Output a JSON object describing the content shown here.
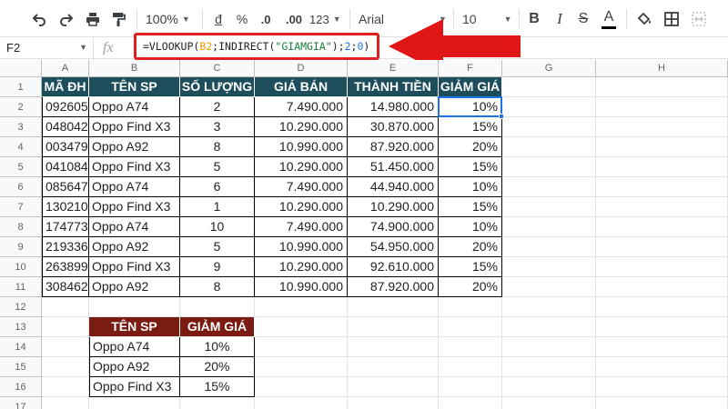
{
  "toolbar": {
    "zoom": "100%",
    "currency": "đ",
    "percent": "%",
    "dec_decrease": ".0",
    "dec_increase": ".00",
    "more_formats": "123",
    "font": "Arial",
    "font_size": "10",
    "bold": "B",
    "italic": "I",
    "strike": "S",
    "text_color": "A"
  },
  "formula_bar": {
    "name_box": "F2",
    "fx": "fx",
    "formula_parts": {
      "p1": "=VLOOKUP(",
      "ref": "B2",
      "p2": ";INDIRECT(",
      "str": "\"GIAMGIA\"",
      "p3": ");",
      "n1": "2",
      "p4": ";",
      "n2": "0",
      "p5": ")"
    }
  },
  "columns": [
    "A",
    "B",
    "C",
    "D",
    "E",
    "F",
    "G",
    "H"
  ],
  "rows": [
    "1",
    "2",
    "3",
    "4",
    "5",
    "6",
    "7",
    "8",
    "9",
    "10",
    "11",
    "12",
    "13",
    "14",
    "15",
    "16",
    "17"
  ],
  "table": {
    "headers": [
      "MÃ ĐH",
      "TÊN SP",
      "SỐ LƯỢNG",
      "GIÁ BÁN",
      "THÀNH TIỀN",
      "GIẢM GIÁ"
    ],
    "rows": [
      [
        "092605",
        "Oppo A74",
        "2",
        "7.490.000",
        "14.980.000",
        "10%"
      ],
      [
        "048042",
        "Oppo Find X3",
        "3",
        "10.290.000",
        "30.870.000",
        "15%"
      ],
      [
        "003479",
        "Oppo A92",
        "8",
        "10.990.000",
        "87.920.000",
        "20%"
      ],
      [
        "041084",
        "Oppo Find X3",
        "5",
        "10.290.000",
        "51.450.000",
        "15%"
      ],
      [
        "085647",
        "Oppo A74",
        "6",
        "7.490.000",
        "44.940.000",
        "10%"
      ],
      [
        "130210",
        "Oppo Find X3",
        "1",
        "10.290.000",
        "10.290.000",
        "15%"
      ],
      [
        "174773",
        "Oppo A74",
        "10",
        "7.490.000",
        "74.900.000",
        "10%"
      ],
      [
        "219336",
        "Oppo A92",
        "5",
        "10.990.000",
        "54.950.000",
        "20%"
      ],
      [
        "263899",
        "Oppo Find X3",
        "9",
        "10.290.000",
        "92.610.000",
        "15%"
      ],
      [
        "308462",
        "Oppo A92",
        "8",
        "10.990.000",
        "87.920.000",
        "20%"
      ]
    ]
  },
  "lookup": {
    "headers": [
      "TÊN SP",
      "GIẢM GIÁ"
    ],
    "rows": [
      [
        "Oppo A74",
        "10%"
      ],
      [
        "Oppo A92",
        "20%"
      ],
      [
        "Oppo Find X3",
        "15%"
      ]
    ]
  },
  "colors": {
    "header_dark": "#1e4e5c",
    "header_red": "#7b1c12",
    "annotation_red": "#e02020",
    "selection": "#1a73e8"
  }
}
